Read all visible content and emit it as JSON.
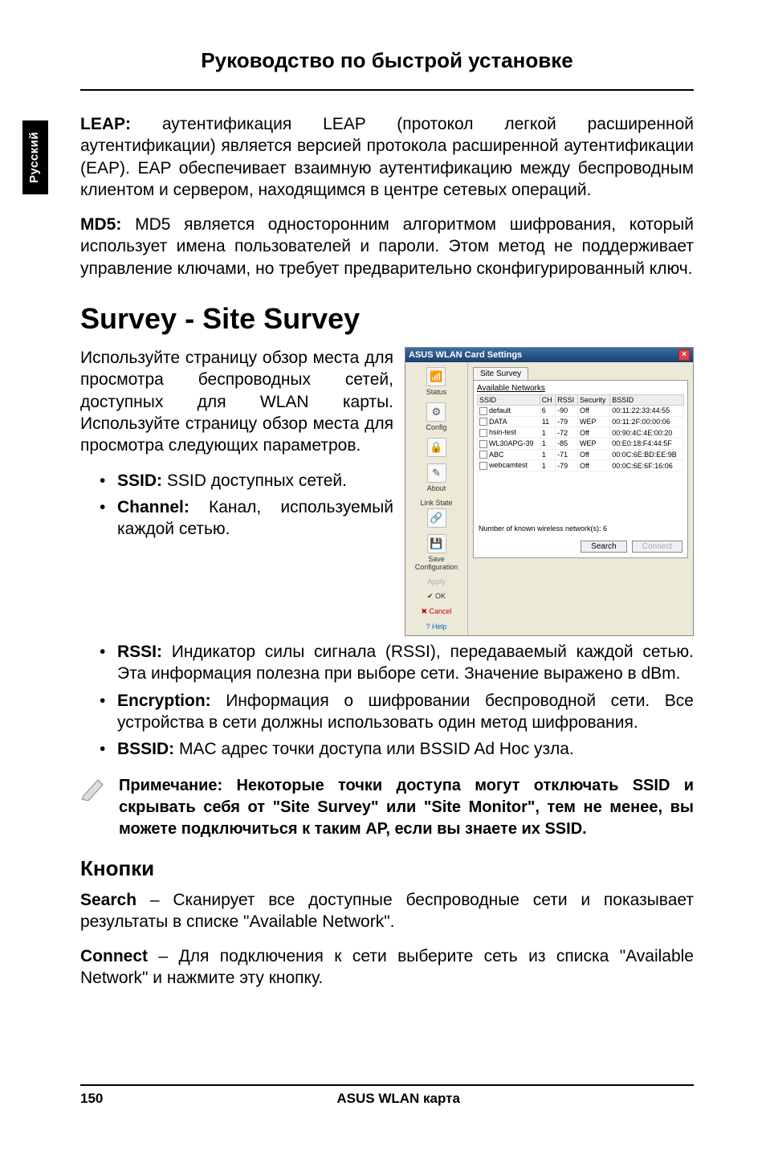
{
  "sideTab": "Русский",
  "headerTitle": "Руководство по быстрой установке",
  "leap": {
    "label": "LEAP:",
    "text": " аутентификация LEAP (протокол легкой расширенной аутентификации) является версией протокола расширенной аутентификации (EAP). EAP обеспечивает взаимную аутентификацию между беспроводным клиентом и сервером, находящимся в центре сетевых операций."
  },
  "md5": {
    "label": "MD5:",
    "text": " MD5 является односторонним алгоритмом шифрования, который использует имена пользователей и пароли. Этом метод не поддерживает управление ключами, но требует предварительно сконфигурированный ключ."
  },
  "surveyHeading": "Survey - Site Survey",
  "surveyIntro": "Используйте страницу обзор места для просмотра беспроводных сетей, доступных для WLAN карты. Используйте страницу обзор места для просмотра следующих параметров.",
  "bullets": {
    "ssid": {
      "label": "SSID:",
      "text": "  SSID доступных сетей."
    },
    "channel": {
      "label": "Channel:",
      "text": " Канал, используемый каждой сетью."
    },
    "rssi": {
      "label": "RSSI:",
      "text": " Индикатор силы сигнала (RSSI), передаваемый каждой сетью. Эта информация полезна при выборе сети. Значение выражено в dBm."
    },
    "encryption": {
      "label": "Encryption:",
      "text": " Информация о шифровании беспроводной сети. Все устройства в сети должны использовать один метод шифрования."
    },
    "bssid": {
      "label": "BSSID:",
      "text": " MAC адрес точки доступа или BSSID  Ad Hoc узла."
    }
  },
  "note": "Примечание: Некоторые точки доступа могут отключать SSID и скрывать себя от \"Site Survey\" или \"Site Monitor\", тем не менее, вы можете подключиться к таким AP, если вы знаете их SSID.",
  "buttonsHeading": "Кнопки",
  "searchBtn": {
    "label": "Search",
    "text": " – Сканирует все доступные беспроводные сети и показывает результаты в списке  \"Available Network\"."
  },
  "connectBtn": {
    "label": "Connect",
    "text": " – Для подключения к сети выберите сеть из списка  \"Available Network\" и нажмите эту кнопку."
  },
  "footer": {
    "page": "150",
    "title": "ASUS WLAN карта"
  },
  "screenshot": {
    "title": "ASUS WLAN Card Settings",
    "sidebar": {
      "status": "Status",
      "config": "Config",
      "encryptIcon": "🔒",
      "about": "About",
      "linkState": "Link State",
      "saveConfig": "Save Configuration",
      "apply": "Apply",
      "ok": "OK",
      "cancel": "Cancel",
      "help": "Help"
    },
    "tab": "Site Survey",
    "panelLabel": "Available Networks",
    "columns": {
      "ssid": "SSID",
      "ch": "CH",
      "rssi": "RSSI",
      "security": "Security",
      "bssid": "BSSID"
    },
    "rows": [
      {
        "ssid": "default",
        "ch": "6",
        "rssi": "-90",
        "sec": "Off",
        "bssid": "00:11:22:33:44:55"
      },
      {
        "ssid": "DATA",
        "ch": "11",
        "rssi": "-79",
        "sec": "WEP",
        "bssid": "00:11:2F:00:00:06"
      },
      {
        "ssid": "hsin-test",
        "ch": "1",
        "rssi": "-72",
        "sec": "Off",
        "bssid": "00:90:4C:4E:00:20"
      },
      {
        "ssid": "WL30APG-39",
        "ch": "1",
        "rssi": "-85",
        "sec": "WEP",
        "bssid": "00:E0:18:F4:44:5F"
      },
      {
        "ssid": "ABC",
        "ch": "1",
        "rssi": "-71",
        "sec": "Off",
        "bssid": "00:0C:6E:BD:EE:9B"
      },
      {
        "ssid": "webcamtest",
        "ch": "1",
        "rssi": "-79",
        "sec": "Off",
        "bssid": "00:0C:6E:6F:16:06"
      }
    ],
    "countLabel": "Number of known wireless network(s): 6",
    "buttons": {
      "search": "Search",
      "connect": "Connect"
    }
  }
}
